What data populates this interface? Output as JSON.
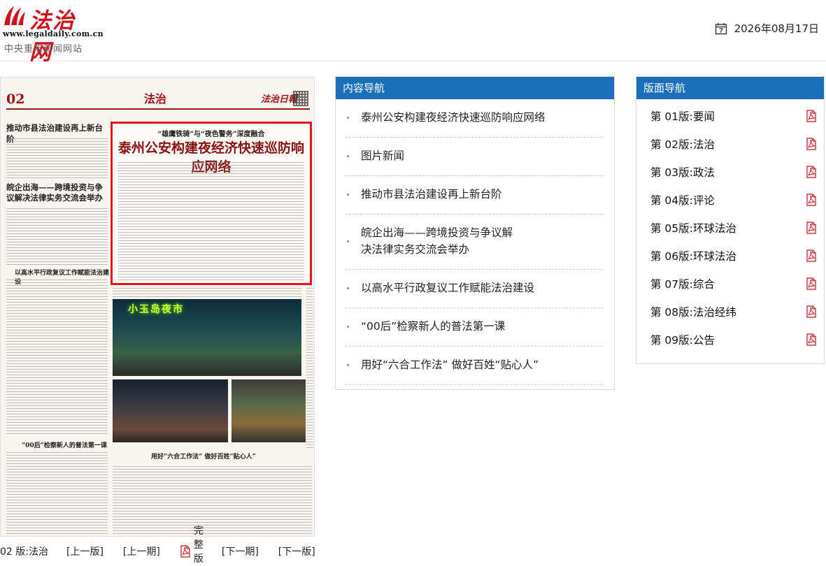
{
  "header": {
    "logo_title": "法治网",
    "logo_url": "www.legaldaily.com.cn",
    "logo_slogan": "中央重点新闻网站",
    "date": "2026年08月17日"
  },
  "newspaper": {
    "page_number": "02",
    "section": "法治",
    "brand": "法治日報",
    "headline_kicker": "“雄鹰铁骑”与“夜色警务”深度融合",
    "headline": "泰州公安构建夜经济快速巡防响应网络",
    "side_headline_1": "推动市县法治建设再上新台阶",
    "side_headline_2": "皖企出海——跨境投资与争议解决法律实务交流会举办",
    "side_headline_3": "以高水平行政复议工作赋能法治建设",
    "side_headline_4": "“00后”检察新人的普法第一课",
    "bottom_headline": "用好“六合工作法” 做好百姓“贴心人”",
    "photo_sign": "小玉岛夜市"
  },
  "bottom_nav": {
    "current_page": "02 版:法治",
    "prev_page": "[上一版]",
    "prev_article": "[上一期]",
    "full_pdf": "完整版面",
    "next_article": "[下一期]",
    "next_page": "[下一版]"
  },
  "content_nav": {
    "title": "内容导航",
    "items": [
      "泰州公安构建夜经济快速巡防响应网络",
      "图片新闻",
      "推动市县法治建设再上新台阶",
      "皖企出海——跨境投资与争议解决法律实务交流会举办",
      "以高水平行政复议工作赋能法治建设",
      "“00后”检察新人的普法第一课",
      "用好“六合工作法” 做好百姓“贴心人”"
    ]
  },
  "layout_nav": {
    "title": "版面导航",
    "items": [
      "第 01版:要闻",
      "第 02版:法治",
      "第 03版:政法",
      "第 04版:评论",
      "第 05版:环球法治",
      "第 06版:环球法治",
      "第 07版:综合",
      "第 08版:法治经纬",
      "第 09版:公告"
    ]
  },
  "colors": {
    "accent_blue": "#1a6fb8",
    "brand_red": "#d0101a",
    "highlight_red": "#e8141c"
  }
}
